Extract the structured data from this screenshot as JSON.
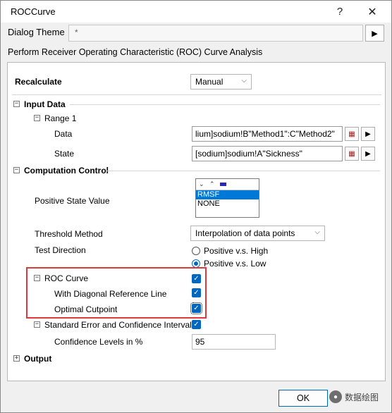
{
  "window": {
    "title": "ROCCurve",
    "help_glyph": "?",
    "close_glyph": "✕"
  },
  "theme": {
    "label": "Dialog Theme",
    "value": "*",
    "arrow_glyph": "▶"
  },
  "description": "Perform Receiver Operating Characteristic (ROC) Curve Analysis",
  "recalculate": {
    "label": "Recalculate",
    "value": "Manual"
  },
  "input_data": {
    "label": "Input Data",
    "range": {
      "label": "Range 1",
      "data_label": "Data",
      "data_value": "lium]sodium!B\"Method1\":C\"Method2\"",
      "state_label": "State",
      "state_value": "[sodium]sodium!A\"Sickness\""
    }
  },
  "computation": {
    "label": "Computation Control",
    "positive_state": {
      "label": "Positive State Value",
      "options": [
        "RMSF",
        "NONE"
      ],
      "selected": "RMSF"
    },
    "threshold": {
      "label": "Threshold Method",
      "value": "Interpolation of data points"
    },
    "test_direction": {
      "label": "Test Direction",
      "options": [
        "Positive v.s. High",
        "Positive v.s. Low"
      ],
      "selected": "Positive v.s. Low"
    },
    "roc_curve": {
      "label": "ROC Curve",
      "checked": true
    },
    "diagonal": {
      "label": "With Diagonal Reference Line",
      "checked": true
    },
    "optimal": {
      "label": "Optimal Cutpoint",
      "checked": true
    },
    "std_error": {
      "label": "Standard Error and Confidence Interval",
      "checked": true
    },
    "confidence": {
      "label": "Confidence Levels in %",
      "value": "95"
    }
  },
  "output": {
    "label": "Output"
  },
  "buttons": {
    "ok": "OK"
  },
  "watermark": {
    "text": "数据绘图"
  },
  "colors": {
    "accent": "#0067c0",
    "highlight": "#e0383b"
  }
}
